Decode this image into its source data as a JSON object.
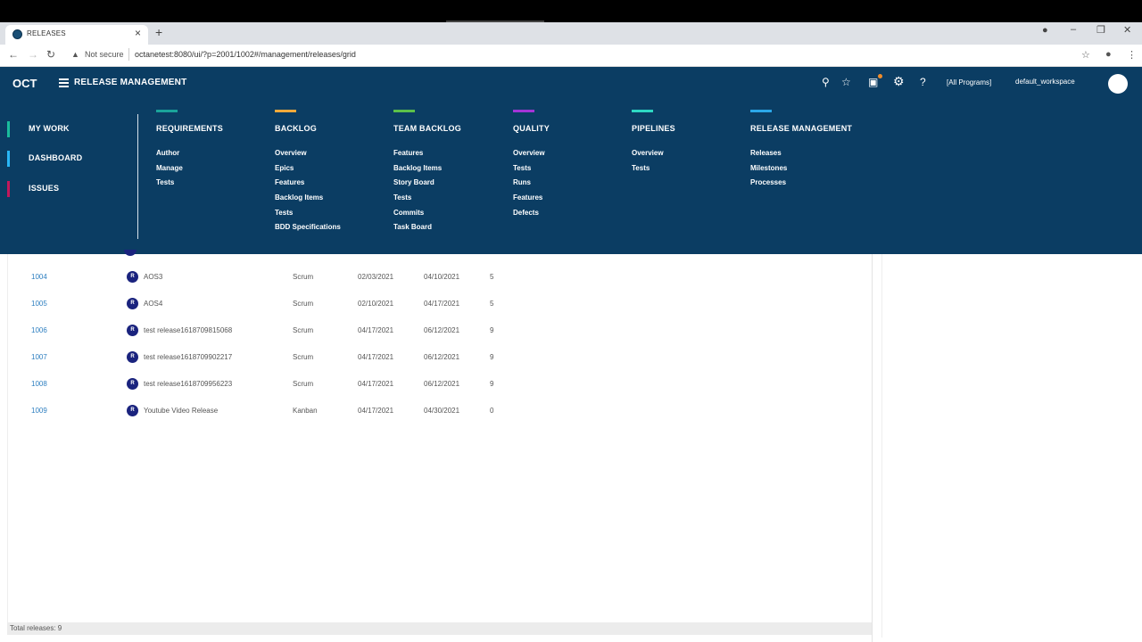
{
  "browser": {
    "tab_title": "RELEASES",
    "new_tab": "+",
    "not_secure": "Not secure",
    "url": "octanetest:8080/ui/?p=2001/1002#/management/releases/grid"
  },
  "header": {
    "logo": "OCT",
    "section_title": "RELEASE MANAGEMENT",
    "program": "[All Programs]",
    "workspace": "default_workspace"
  },
  "left_menu": [
    {
      "label": "MY WORK",
      "color": "#1abc9c"
    },
    {
      "label": "DASHBOARD",
      "color": "#29b6f6"
    },
    {
      "label": "ISSUES",
      "color": "#c2185b"
    }
  ],
  "menu_columns": [
    {
      "title": "REQUIREMENTS",
      "color": "#1aa39a",
      "links": [
        "Author",
        "Manage",
        "Tests"
      ]
    },
    {
      "title": "BACKLOG",
      "color": "#f0a93b",
      "links": [
        "Overview",
        "Epics",
        "Features",
        "Backlog Items",
        "Tests",
        "BDD Specifications"
      ]
    },
    {
      "title": "TEAM BACKLOG",
      "color": "#5cc04a",
      "links": [
        "Features",
        "Backlog Items",
        "Story Board",
        "Tests",
        "Commits",
        "Task Board"
      ]
    },
    {
      "title": "QUALITY",
      "color": "#a335d6",
      "links": [
        "Overview",
        "Tests",
        "Runs",
        "Features",
        "Defects"
      ]
    },
    {
      "title": "PIPELINES",
      "color": "#2ed8c3",
      "links": [
        "Overview",
        "Tests"
      ]
    },
    {
      "title": "RELEASE MANAGEMENT",
      "color": "#2ba7e8",
      "links": [
        "Releases",
        "Milestones",
        "Processes"
      ]
    }
  ],
  "releases": [
    {
      "id": "1004",
      "badge": "R",
      "name": "AOS3",
      "agile": "Scrum",
      "start": "02/03/2021",
      "end": "04/10/2021",
      "count": "5"
    },
    {
      "id": "1005",
      "badge": "R",
      "name": "AOS4",
      "agile": "Scrum",
      "start": "02/10/2021",
      "end": "04/17/2021",
      "count": "5"
    },
    {
      "id": "1006",
      "badge": "R",
      "name": "test release1618709815068",
      "agile": "Scrum",
      "start": "04/17/2021",
      "end": "06/12/2021",
      "count": "9"
    },
    {
      "id": "1007",
      "badge": "R",
      "name": "test release1618709902217",
      "agile": "Scrum",
      "start": "04/17/2021",
      "end": "06/12/2021",
      "count": "9"
    },
    {
      "id": "1008",
      "badge": "R",
      "name": "test release1618709956223",
      "agile": "Scrum",
      "start": "04/17/2021",
      "end": "06/12/2021",
      "count": "9"
    },
    {
      "id": "1009",
      "badge": "R",
      "name": "Youtube Video Release",
      "agile": "Kanban",
      "start": "04/17/2021",
      "end": "04/30/2021",
      "count": "0"
    }
  ],
  "footer": {
    "total": "Total releases: 9"
  }
}
